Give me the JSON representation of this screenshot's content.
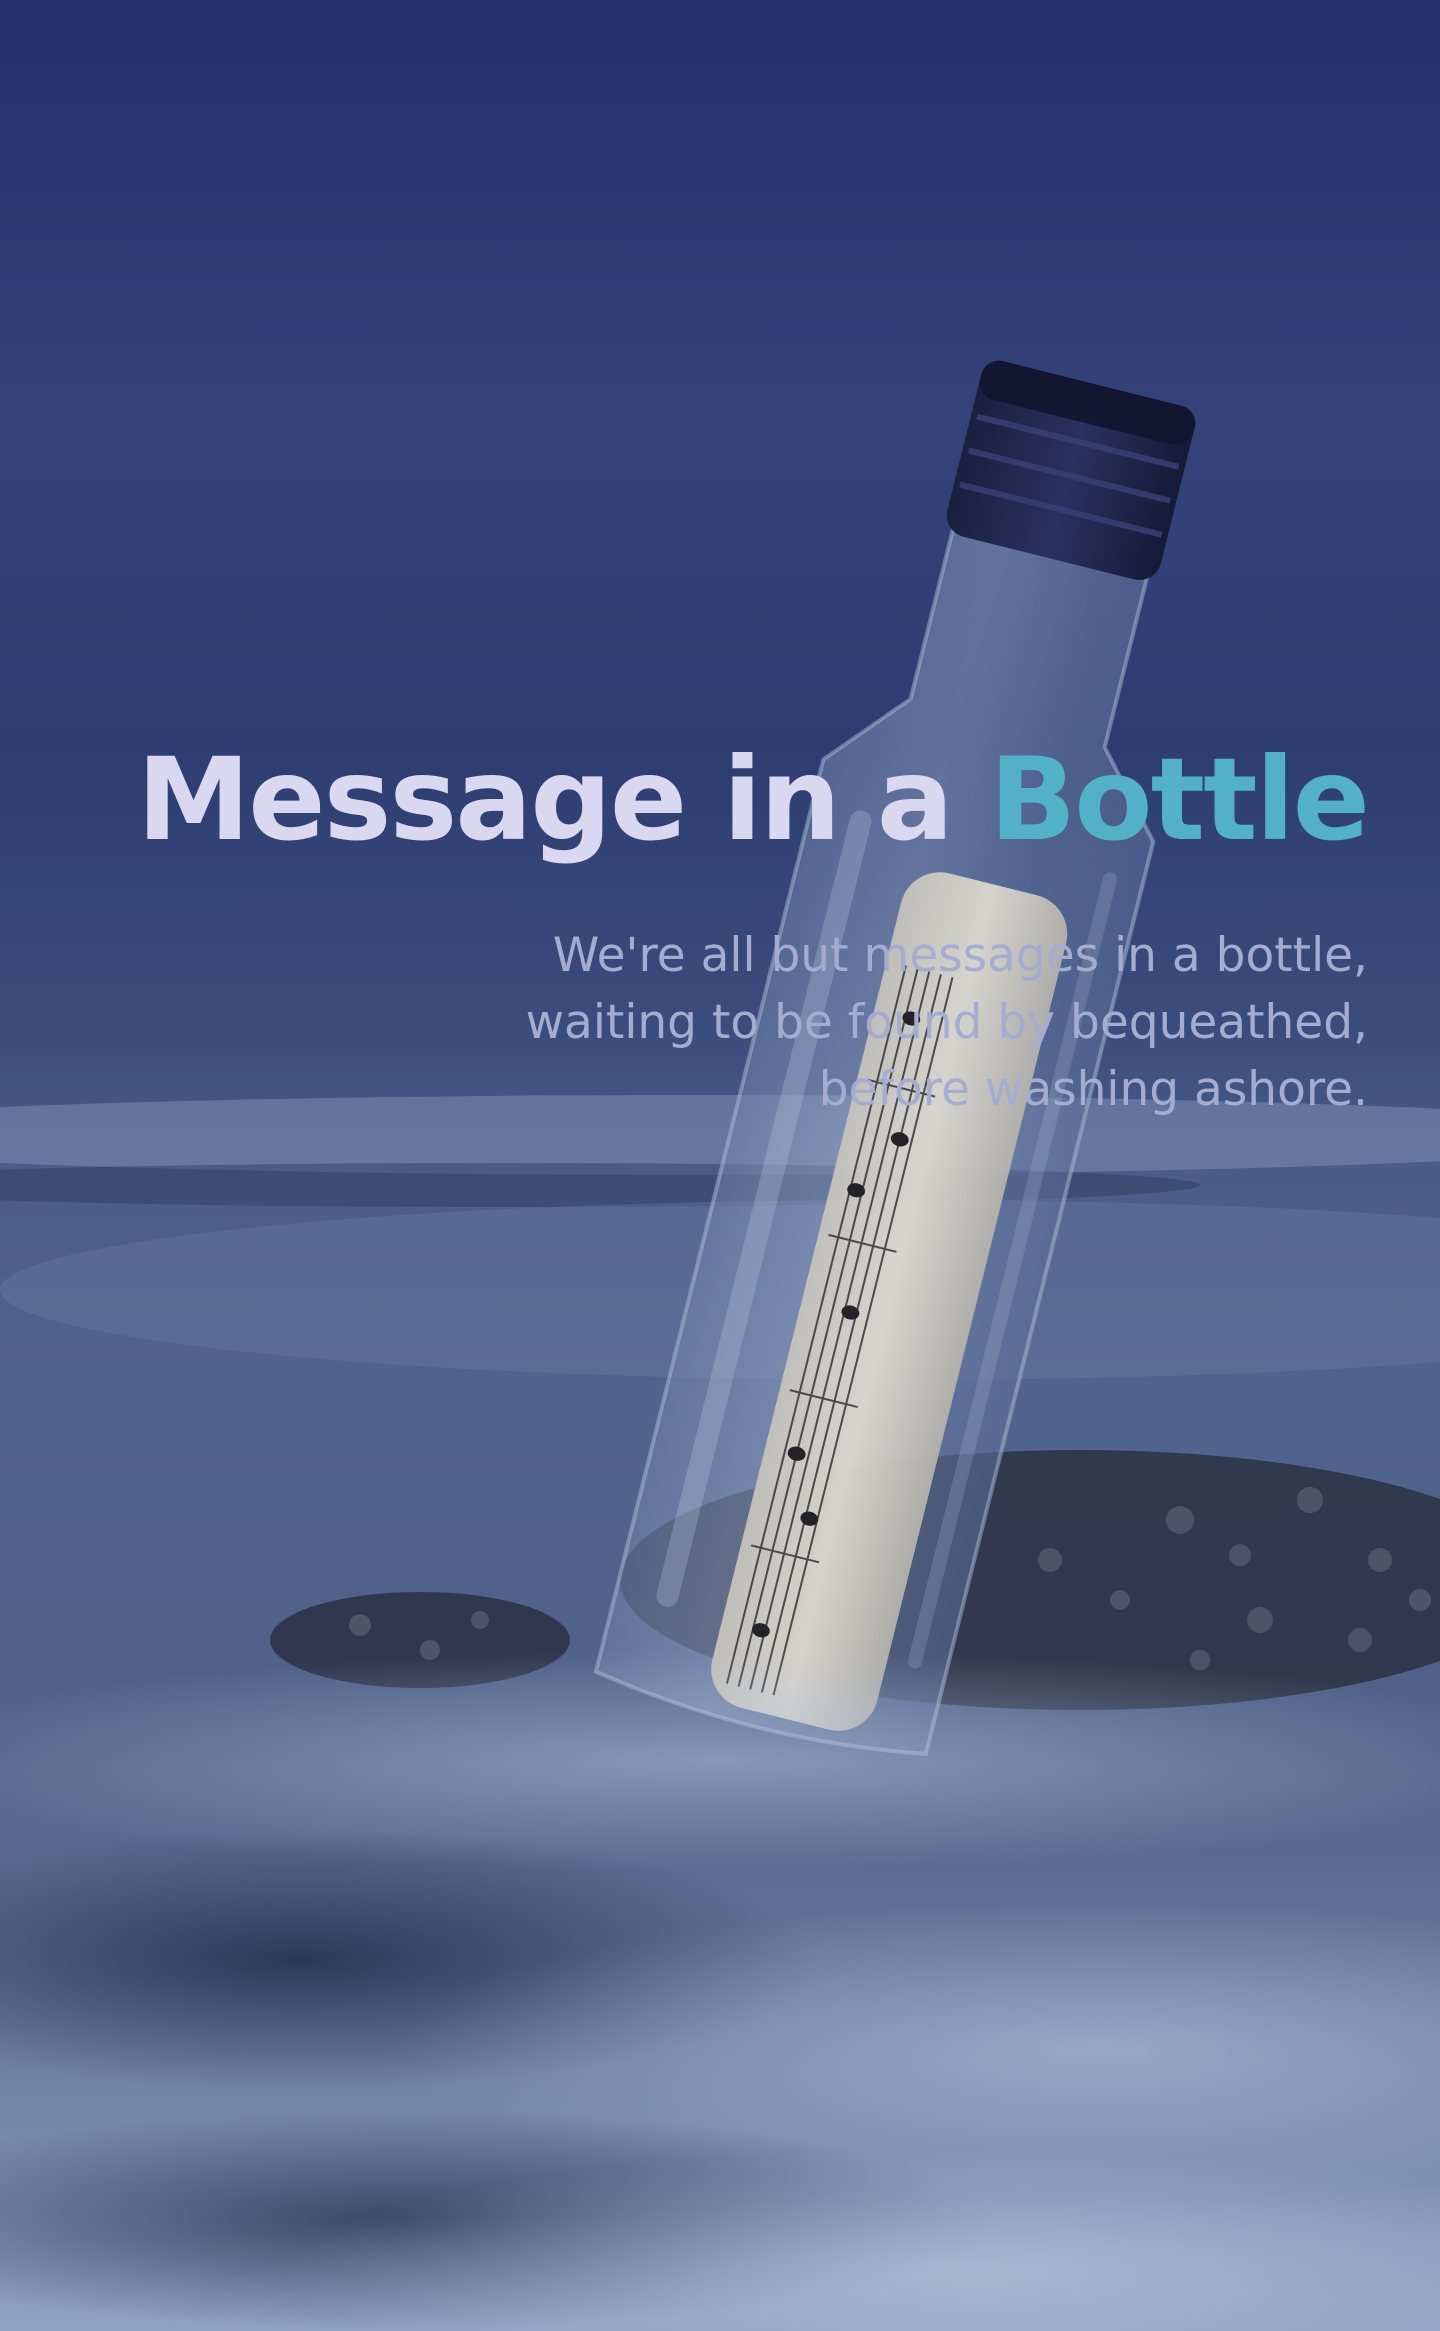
{
  "hero": {
    "title_main": "Message in a",
    "title_accent": "Bottle",
    "tagline_lines": [
      "We're all but messages in a bottle,",
      "waiting to be found by bequeathed,",
      "before washing ashore."
    ],
    "image": "message-bottle-on-beach-photo"
  },
  "colors": {
    "title": "#dad7f0",
    "accent": "#52b0c8",
    "tagline": "#a6acd0",
    "sky": "#27336a",
    "sea": "#4a5e88"
  }
}
